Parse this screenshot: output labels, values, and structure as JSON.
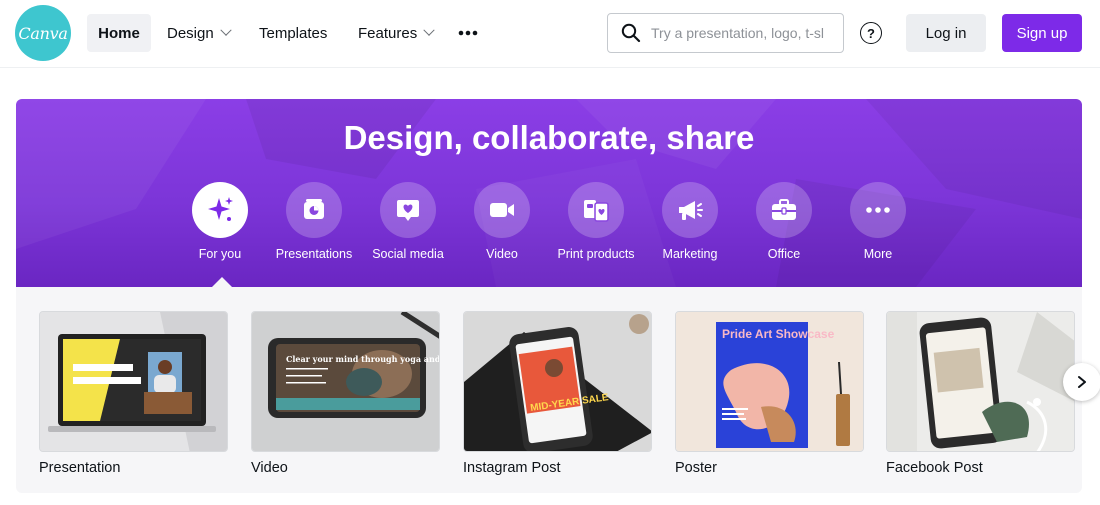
{
  "brand": {
    "logo_text": "Canva",
    "accent": "#7d2ae8",
    "logo_color": "#3ec6cf"
  },
  "nav": {
    "home": "Home",
    "design": "Design",
    "templates": "Templates",
    "features": "Features",
    "more_icon": "more-horizontal-icon"
  },
  "search": {
    "placeholder": "Try a presentation, logo, t-sl",
    "value": ""
  },
  "header_actions": {
    "help_icon": "help-circle-icon",
    "login": "Log in",
    "signup": "Sign up"
  },
  "hero": {
    "title": "Design, collaborate, share",
    "categories": [
      {
        "label": "For you",
        "icon": "sparkle-icon",
        "active": true
      },
      {
        "label": "Presentations",
        "icon": "presentation-chart-icon",
        "active": false
      },
      {
        "label": "Social media",
        "icon": "heart-chat-icon",
        "active": false
      },
      {
        "label": "Video",
        "icon": "video-camera-icon",
        "active": false
      },
      {
        "label": "Print products",
        "icon": "print-products-icon",
        "active": false
      },
      {
        "label": "Marketing",
        "icon": "megaphone-icon",
        "active": false
      },
      {
        "label": "Office",
        "icon": "briefcase-icon",
        "active": false
      },
      {
        "label": "More",
        "icon": "more-horizontal-icon",
        "active": false
      }
    ]
  },
  "templates": [
    {
      "label": "Presentation"
    },
    {
      "label": "Video",
      "thumb_text": "Clear your mind through yoga and meditation."
    },
    {
      "label": "Instagram Post",
      "thumb_text": "MID-YEAR SALE"
    },
    {
      "label": "Poster",
      "thumb_text": "Pride Art Showcase"
    },
    {
      "label": "Facebook Post"
    }
  ],
  "carousel": {
    "next_icon": "chevron-right-icon"
  }
}
